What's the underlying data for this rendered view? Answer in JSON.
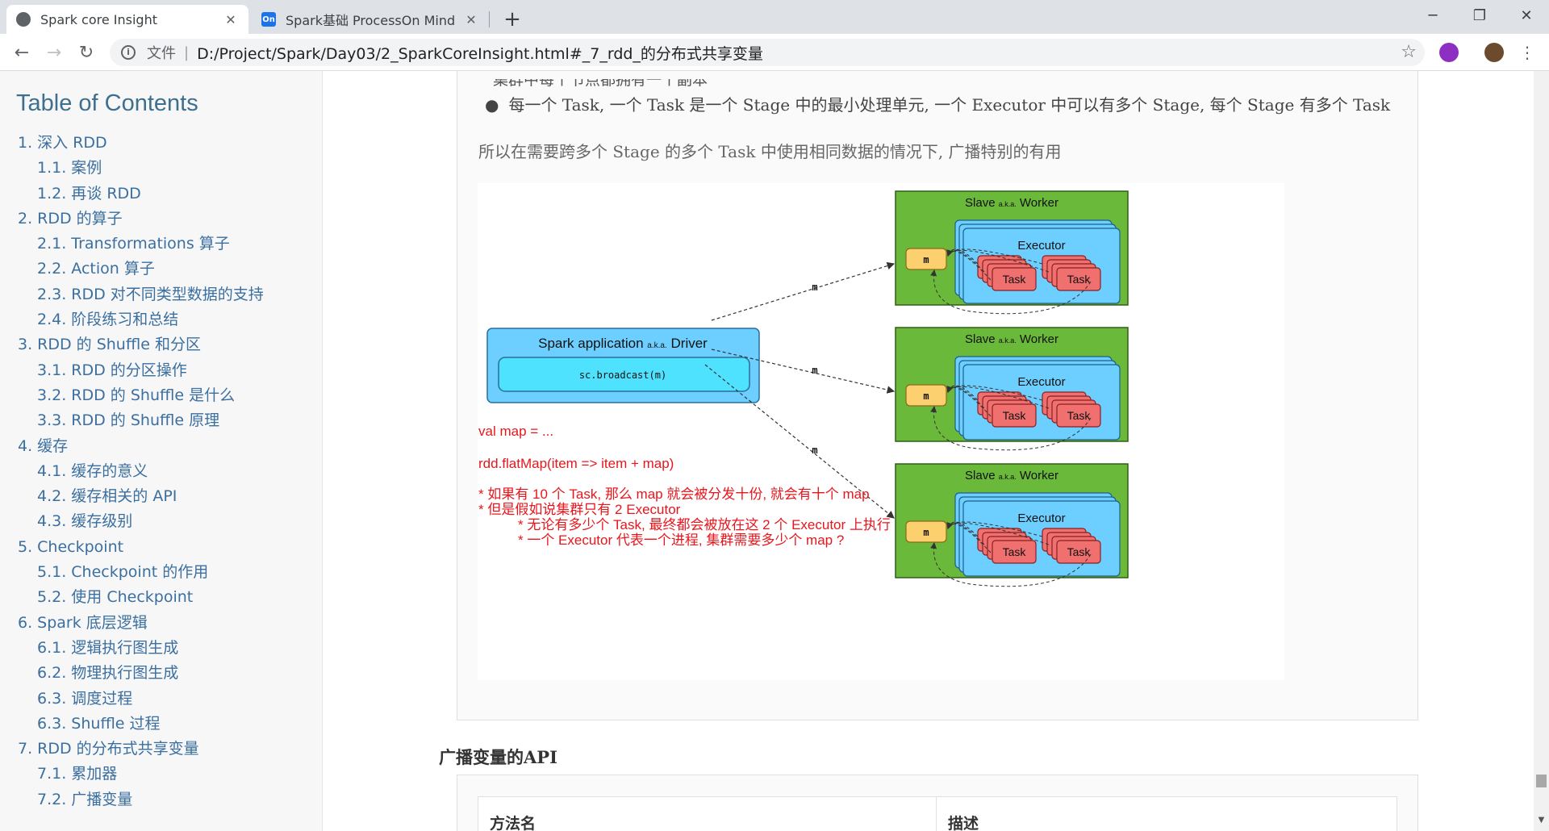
{
  "browser": {
    "tabs": [
      {
        "title": "Spark core Insight",
        "active": true
      },
      {
        "title": "Spark基础 ProcessOn Mind",
        "active": false
      }
    ],
    "address": {
      "scheme_label": "文件",
      "url": "D:/Project/Spark/Day03/2_SparkCoreInsight.html#_7_rdd_的分布式共享变量"
    }
  },
  "toc": {
    "title": "Table of Contents",
    "items": [
      {
        "text": "1. 深入 RDD",
        "level": 1
      },
      {
        "text": "1.1. 案例",
        "level": 2
      },
      {
        "text": "1.2. 再谈 RDD",
        "level": 2
      },
      {
        "text": "2. RDD 的算子",
        "level": 1
      },
      {
        "text": "2.1. Transformations 算子",
        "level": 2
      },
      {
        "text": "2.2. Action 算子",
        "level": 2
      },
      {
        "text": "2.3. RDD 对不同类型数据的支持",
        "level": 2
      },
      {
        "text": "2.4. 阶段练习和总结",
        "level": 2
      },
      {
        "text": "3. RDD 的 Shuffle 和分区",
        "level": 1
      },
      {
        "text": "3.1. RDD 的分区操作",
        "level": 2
      },
      {
        "text": "3.2. RDD 的 Shuffle 是什么",
        "level": 2
      },
      {
        "text": "3.3. RDD 的 Shuffle 原理",
        "level": 2
      },
      {
        "text": "4. 缓存",
        "level": 1
      },
      {
        "text": "4.1. 缓存的意义",
        "level": 2
      },
      {
        "text": "4.2. 缓存相关的 API",
        "level": 2
      },
      {
        "text": "4.3. 缓存级别",
        "level": 2
      },
      {
        "text": "5. Checkpoint",
        "level": 1
      },
      {
        "text": "5.1. Checkpoint 的作用",
        "level": 2
      },
      {
        "text": "5.2. 使用 Checkpoint",
        "level": 2
      },
      {
        "text": "6. Spark 底层逻辑",
        "level": 1
      },
      {
        "text": "6.1. 逻辑执行图生成",
        "level": 2
      },
      {
        "text": "6.2. 物理执行图生成",
        "level": 2
      },
      {
        "text": "6.3. 调度过程",
        "level": 2
      },
      {
        "text": "6.3. Shuffle 过程",
        "level": 2
      },
      {
        "text": "7. RDD 的分布式共享变量",
        "level": 1
      },
      {
        "text": "7.1. 累加器",
        "level": 2
      },
      {
        "text": "7.2. 广播变量",
        "level": 2
      }
    ]
  },
  "content": {
    "cut_line": "集群中每个节点都拥有一个副本",
    "bullet": "每一个 Task, 一个 Task 是一个 Stage 中的最小处理单元, 一个 Executor 中可以有多个 Stage, 每个 Stage 有多个 Task",
    "paragraph": "所以在需要跨多个 Stage 的多个 Task 中使用相同数据的情况下, 广播特别的有用",
    "diagram": {
      "driver_title": "Spark application",
      "driver_aka": "a.k.a.",
      "driver_role": "Driver",
      "driver_code": "sc.broadcast(m)",
      "worker_title": "Slave",
      "worker_aka": "a.k.a.",
      "worker_role": "Worker",
      "executor_label": "Executor",
      "task_label": "Task",
      "var_label": "m",
      "arrow_label": "m",
      "notes": [
        "val map = ...",
        "rdd.flatMap(item => item + map)",
        "* 如果有 10 个 Task, 那么 map 就会被分发十份, 就会有十个 map",
        "* 但是假如说集群只有 2 Executor",
        "* 无论有多少个 Task, 最终都会被放在这 2 个 Executor 上执行",
        "* 一个 Executor 代表一个进程, 集群需要多少个 map ?"
      ]
    },
    "section_heading": "广播变量的API",
    "table_headers": [
      "方法名",
      "描述"
    ]
  },
  "colors": {
    "toc_link": "#3b6fa0",
    "worker_green": "#6ab93b",
    "executor_blue": "#6ccfff",
    "task_red": "#f07070",
    "var_yellow": "#fcd06f",
    "note_red": "#e8161c"
  }
}
